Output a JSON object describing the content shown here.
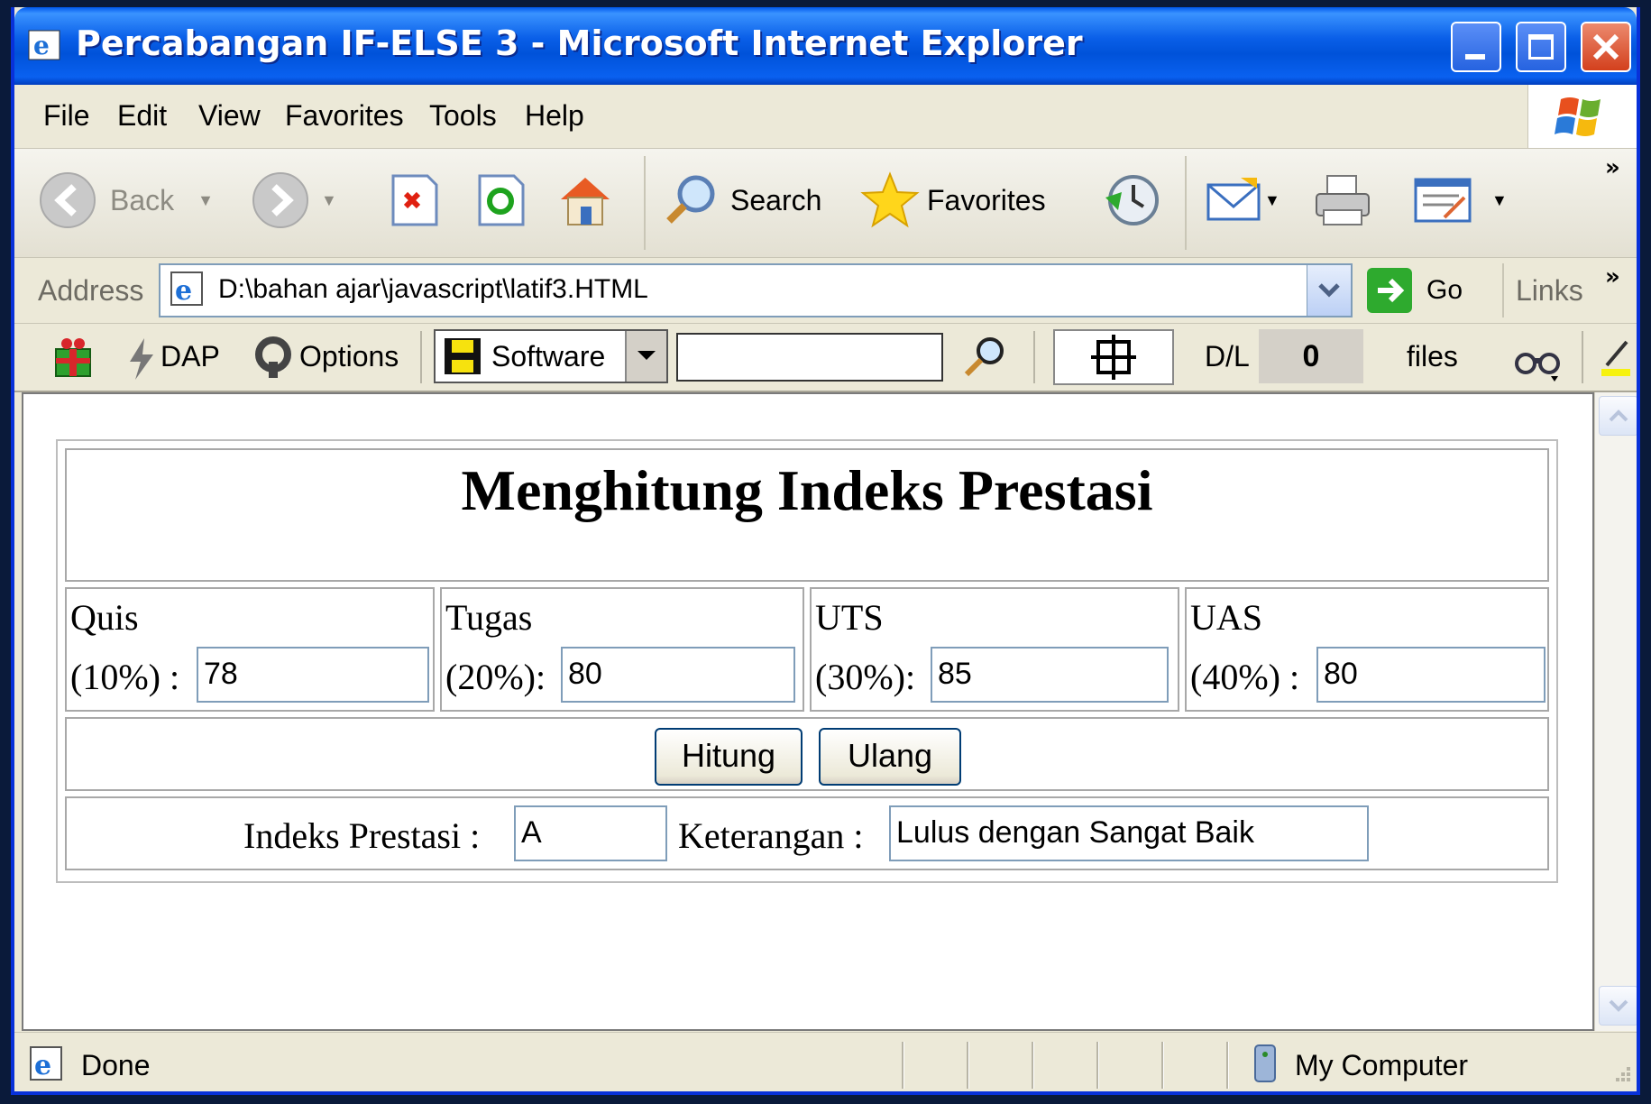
{
  "window": {
    "title": "Percabangan IF-ELSE 3 - Microsoft Internet Explorer"
  },
  "menu": [
    "File",
    "Edit",
    "View",
    "Favorites",
    "Tools",
    "Help"
  ],
  "toolbar": {
    "back_label": "Back",
    "search_label": "Search",
    "favorites_label": "Favorites"
  },
  "address": {
    "label": "Address",
    "url": "D:\\bahan ajar\\javascript\\latif3.HTML",
    "go_label": "Go",
    "links_label": "Links"
  },
  "extra": {
    "dap_label": "DAP",
    "options_label": "Options",
    "software_label": "Software",
    "dl_label": "D/L",
    "dl_value": "0",
    "files_label": "files"
  },
  "page": {
    "title": "Menghitung Indeks Prestasi",
    "quis_label_1": "Quis",
    "quis_label_2": "(10%) :",
    "quis_value": "78",
    "tugas_label_1": "Tugas",
    "tugas_label_2": "(20%):",
    "tugas_value": "80",
    "uts_label_1": "UTS",
    "uts_label_2": "(30%):",
    "uts_value": "85",
    "uas_label_1": "UAS",
    "uas_label_2": "(40%) :",
    "uas_value": "80",
    "hitung_label": "Hitung",
    "ulang_label": "Ulang",
    "ip_label": "Indeks Prestasi :",
    "ip_value": "A",
    "ket_label": "Keterangan :",
    "ket_value": "Lulus dengan Sangat Baik"
  },
  "status": {
    "text": "Done",
    "zone": "My Computer"
  },
  "colors": {
    "titlebar": "#0a5fe8",
    "close_button": "#d3401d",
    "content_bg": "#ffffff",
    "chrome_bg": "#ece9d8"
  }
}
